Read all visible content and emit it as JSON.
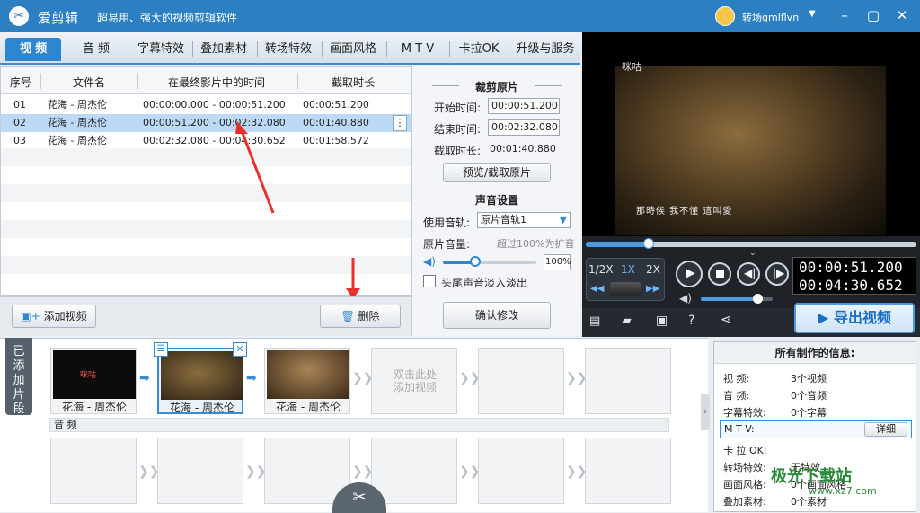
{
  "app": {
    "name": "爱剪辑",
    "slogan": "超易用、强大的视频剪辑软件",
    "user": "转场gmlflvn"
  },
  "tabs": [
    "视 频",
    "音 频",
    "字幕特效",
    "叠加素材",
    "转场特效",
    "画面风格",
    "M T V",
    "卡拉OK",
    "升级与服务"
  ],
  "table": {
    "headers": [
      "序号",
      "文件名",
      "在最终影片中的时间",
      "截取时长"
    ],
    "rows": [
      {
        "idx": "01",
        "name": "花海 - 周杰伦",
        "time": "00:00:00.000 - 00:00:51.200",
        "dur": "00:00:51.200"
      },
      {
        "idx": "02",
        "name": "花海 - 周杰伦",
        "time": "00:00:51.200 - 00:02:32.080",
        "dur": "00:01:40.880"
      },
      {
        "idx": "03",
        "name": "花海 - 周杰伦",
        "time": "00:02:32.080 - 00:04:30.652",
        "dur": "00:01:58.572"
      }
    ],
    "more_icon": "⋮"
  },
  "cut": {
    "title": "裁剪原片",
    "start_label": "开始时间:",
    "start": "00:00:51.200",
    "end_label": "结束时间:",
    "end": "00:02:32.080",
    "dur_label": "截取时长:",
    "dur": "00:01:40.880",
    "preview_btn": "预览/截取原片"
  },
  "sound": {
    "title": "声音设置",
    "track_label": "使用音轨:",
    "track": "原片音轨1",
    "vol_label": "原片音量:",
    "vol_hint": "超过100%为扩音",
    "vol": "100%",
    "vol_level": 0.35,
    "fade_label": "头尾声音淡入淡出",
    "confirm": "确认修改"
  },
  "buttons": {
    "add_video": "添加视频",
    "delete": "删除"
  },
  "video": {
    "watermark": "咪咕",
    "subtitle": "那時候  我不懂  這叫愛"
  },
  "player": {
    "speeds": [
      "1/2X",
      "1X",
      "2X"
    ],
    "time_current": "00:00:51.200",
    "time_total": "00:04:30.652",
    "export": "导出视频",
    "progress": 0.19,
    "volume_level": 0.8
  },
  "clips": {
    "side_label": "已添加片段",
    "items": [
      {
        "label": "花海 - 周杰伦"
      },
      {
        "label": "花海 - 周杰伦"
      },
      {
        "label": "花海 - 周杰伦"
      }
    ],
    "empty_hint": "双击此处\n添加视频",
    "audio_label": "音 频"
  },
  "info": {
    "title": "所有制作的信息:",
    "rows": [
      {
        "k": "视    频:",
        "v": "3个视频"
      },
      {
        "k": "音    频:",
        "v": "0个音频"
      },
      {
        "k": "字幕特效:",
        "v": "0个字幕"
      },
      {
        "k": "M  T  V:",
        "v": ""
      },
      {
        "k": "卡 拉 OK:",
        "v": ""
      },
      {
        "k": "转场特效:",
        "v": "无特效"
      },
      {
        "k": "画面风格:",
        "v": "0个画面风格"
      },
      {
        "k": "叠加素材:",
        "v": "0个素材"
      }
    ],
    "detail": "详细"
  },
  "overlay": {
    "site": "极光下载站",
    "url": "www.xz7.com"
  }
}
